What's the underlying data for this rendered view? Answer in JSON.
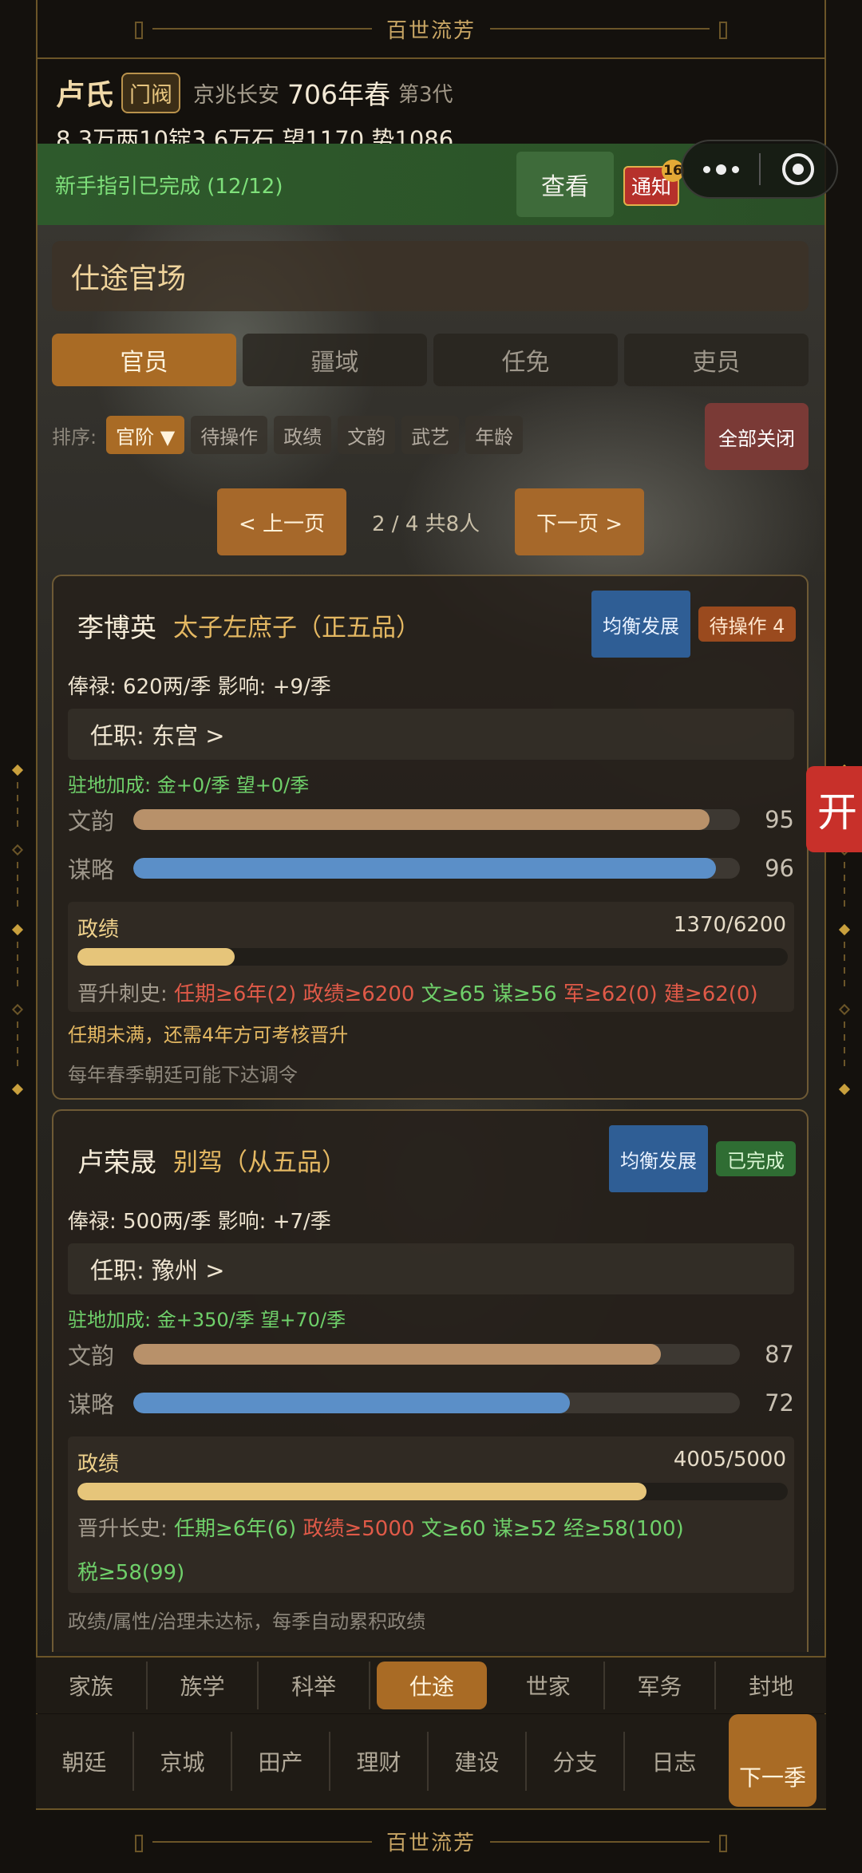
{
  "app": {
    "brand_top": "百世流芳",
    "brand_bottom": "百世流芳"
  },
  "header": {
    "surname": "卢氏",
    "rank_tag": "门阀",
    "location": "京兆长安",
    "year": "706年春",
    "generation": "第3代",
    "resources": "8.3万两10锭3.6万石  望1170  势1086"
  },
  "guide": {
    "text": "新手指引已完成 (12/12)",
    "view_label": "查看",
    "notify_label": "通知",
    "notify_count": "16"
  },
  "section": {
    "title": "仕途官场"
  },
  "tabs": [
    {
      "label": "官员"
    },
    {
      "label": "疆域"
    },
    {
      "label": "任免"
    },
    {
      "label": "吏员"
    }
  ],
  "sort": {
    "label": "排序:",
    "options": [
      {
        "label": "官阶 ▼"
      },
      {
        "label": "待操作"
      },
      {
        "label": "政绩"
      },
      {
        "label": "文韵"
      },
      {
        "label": "武艺"
      },
      {
        "label": "年龄"
      }
    ],
    "close_all": "全部关闭"
  },
  "pager": {
    "prev": "< 上一页",
    "info": "2 / 4  共8人",
    "next": "下一页 >"
  },
  "officials": [
    {
      "name": "李博英",
      "title": "太子左庶子（正五品）",
      "style": "均衡发展",
      "status": "待操作 4",
      "pay": "俸禄: 620两/季   影响: +9/季",
      "post": "任职: 东宫  >",
      "bonus": "驻地加成: 金+0/季  望+0/季",
      "stats": [
        {
          "label": "文韵",
          "value": 95,
          "display": "95",
          "color": "#b8916a"
        },
        {
          "label": "谋略",
          "value": 96,
          "display": "96",
          "color": "#5b8fc8"
        }
      ],
      "merit": {
        "label": "政绩",
        "current": 1370,
        "max": 6200,
        "display": "1370/6200"
      },
      "req_line1": [
        {
          "t": "晋升刺史: ",
          "c": "base"
        },
        {
          "t": "任期≥6年(2) ",
          "c": "bad"
        },
        {
          "t": "政绩≥6200 ",
          "c": "bad"
        },
        {
          "t": "文≥65 ",
          "c": "ok"
        },
        {
          "t": "谋≥56 ",
          "c": "ok"
        },
        {
          "t": "军≥62(0) ",
          "c": "bad"
        },
        {
          "t": "建≥62(0)",
          "c": "bad"
        }
      ],
      "note1": "任期未满，还需4年方可考核晋升",
      "note2": "每年春季朝廷可能下达调令"
    },
    {
      "name": "卢荣晟",
      "title": "别驾（从五品）",
      "style": "均衡发展",
      "status": "已完成",
      "pay": "俸禄: 500两/季   影响: +7/季",
      "post": "任职: 豫州  >",
      "bonus": "驻地加成: 金+350/季  望+70/季",
      "stats": [
        {
          "label": "文韵",
          "value": 87,
          "display": "87",
          "color": "#b8916a"
        },
        {
          "label": "谋略",
          "value": 72,
          "display": "72",
          "color": "#5b8fc8"
        }
      ],
      "merit": {
        "label": "政绩",
        "current": 4005,
        "max": 5000,
        "display": "4005/5000"
      },
      "req_line1": [
        {
          "t": "晋升长史: ",
          "c": "base"
        },
        {
          "t": "任期≥6年(6) ",
          "c": "ok"
        },
        {
          "t": "政绩≥5000 ",
          "c": "bad"
        },
        {
          "t": "文≥60 ",
          "c": "ok"
        },
        {
          "t": "谋≥52 ",
          "c": "ok"
        },
        {
          "t": "经≥58(100)",
          "c": "ok"
        }
      ],
      "req_line2": [
        {
          "t": "税≥58(99)",
          "c": "ok"
        }
      ],
      "note2": "政绩/属性/治理未达标，每季自动累积政绩"
    }
  ],
  "side_tab": "开",
  "nav1": [
    {
      "label": "家族"
    },
    {
      "label": "族学"
    },
    {
      "label": "科举"
    },
    {
      "label": "仕途"
    },
    {
      "label": "世家"
    },
    {
      "label": "军务"
    },
    {
      "label": "封地"
    }
  ],
  "nav2": [
    {
      "label": "朝廷"
    },
    {
      "label": "京城"
    },
    {
      "label": "田产"
    },
    {
      "label": "理财"
    },
    {
      "label": "建设"
    },
    {
      "label": "分支"
    },
    {
      "label": "日志"
    }
  ],
  "next_season": "下一季",
  "colors": {
    "accent": "#a96b25",
    "gold": "#e4b862",
    "ok": "#6fd06a",
    "bad": "#e05a48"
  }
}
